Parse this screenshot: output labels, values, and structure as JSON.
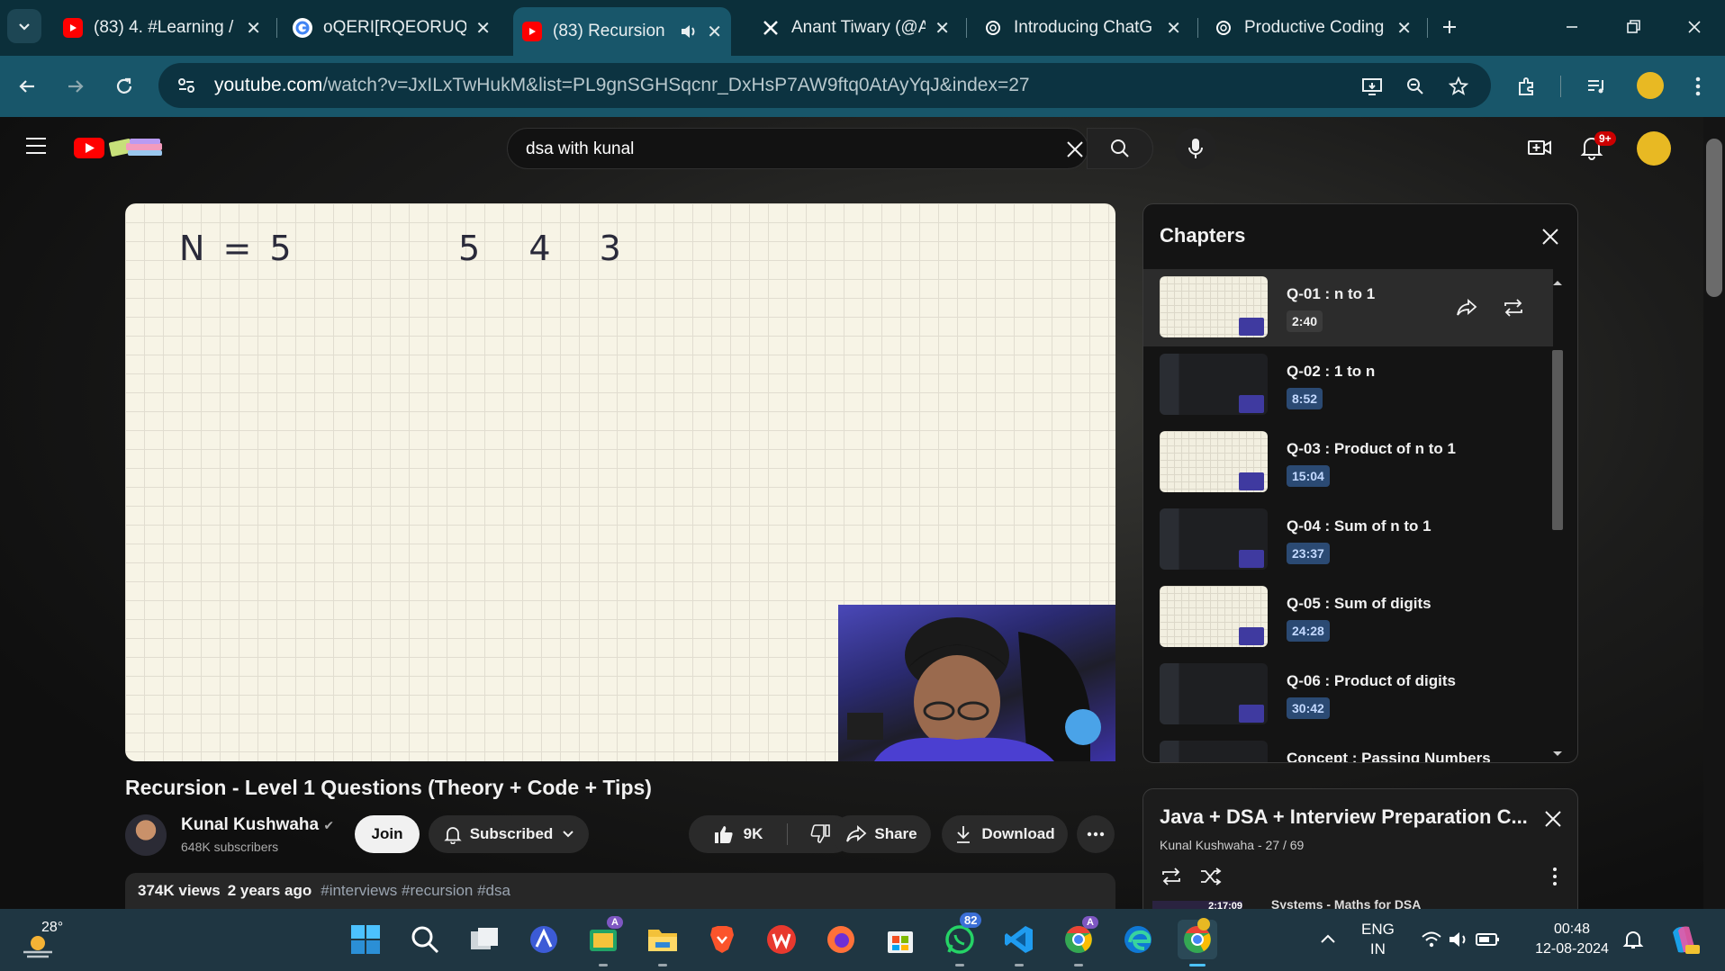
{
  "browser": {
    "tabs": [
      {
        "title": "(83) 4. #Learning /",
        "icon": "youtube"
      },
      {
        "title": "oQERI[RQEORUQE",
        "icon": "google"
      },
      {
        "title": "(83) Recursion",
        "icon": "youtube",
        "active": true
      },
      {
        "title": "Anant Tiwary (@Ar",
        "icon": "x"
      },
      {
        "title": "Introducing ChatG",
        "icon": "openai"
      },
      {
        "title": "Productive Coding",
        "icon": "openai"
      }
    ],
    "url_host": "youtube.com",
    "url_path": "/watch?v=JxILxTwHukM&list=PL9gnSGHSqcnr_DxHsP7AW9ftq0AtAyYqJ&index=27"
  },
  "youtube": {
    "search_value": "dsa with kunal",
    "notif_badge": "9+",
    "board": {
      "n_label": "N = 5",
      "sequence": "5  4  3"
    },
    "video_title": "Recursion - Level 1 Questions (Theory + Code + Tips)",
    "channel": {
      "name": "Kunal Kushwaha",
      "subscribers": "648K subscribers",
      "verified_mark": "✔"
    },
    "join_label": "Join",
    "subscribed_label": "Subscribed",
    "likes": "9K",
    "share_label": "Share",
    "download_label": "Download",
    "views": "374K views",
    "age": "2 years ago",
    "tags": "#interviews #recursion #dsa",
    "chapters_heading": "Chapters",
    "chapters": [
      {
        "title": "Q-01 : n to 1",
        "time": "2:40",
        "thumb": "paper"
      },
      {
        "title": "Q-02 : 1 to n",
        "time": "8:52",
        "thumb": "code"
      },
      {
        "title": "Q-03 : Product of n to 1",
        "time": "15:04",
        "thumb": "paper"
      },
      {
        "title": "Q-04 : Sum of n to 1",
        "time": "23:37",
        "thumb": "code"
      },
      {
        "title": "Q-05 : Sum of digits",
        "time": "24:28",
        "thumb": "paper"
      },
      {
        "title": "Q-06 : Product of digits",
        "time": "30:42",
        "thumb": "code"
      },
      {
        "title": "Concept : Passing Numbers",
        "time": "",
        "thumb": "code"
      }
    ],
    "playlist": {
      "title": "Java + DSA + Interview Preparation C...",
      "owner": "Kunal Kushwaha",
      "position": "27 / 69",
      "peek_title": "Systems - Maths for DSA",
      "peek_duration": "2:17:09"
    }
  },
  "taskbar": {
    "weather_temp": "28°",
    "whatsapp_badge": "82",
    "language_line1": "ENG",
    "language_line2": "IN",
    "time": "00:48",
    "date": "12-08-2024"
  },
  "colors": {
    "browser_frame": "#0b2f3a",
    "browser_toolbar": "#18566a",
    "youtube_red": "#ff0000",
    "whiteboard": "#f7f4e6",
    "chapter_time_badge": "#2b4a73"
  }
}
